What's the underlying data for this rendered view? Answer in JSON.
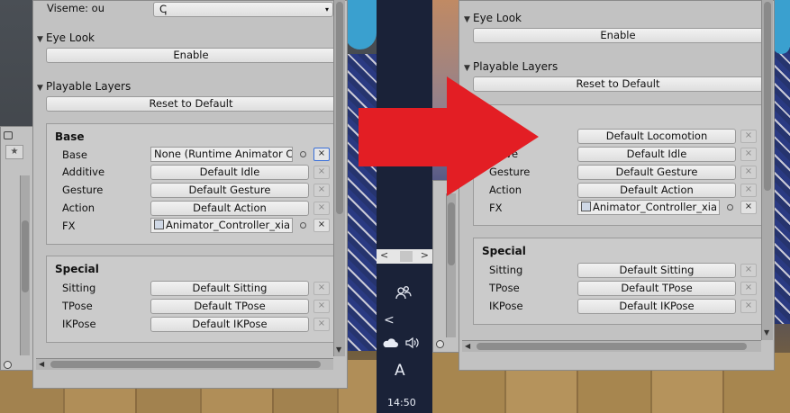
{
  "left_inspector": {
    "viseme_label": "Viseme: ou",
    "viseme_dropdown_value": "ↅ",
    "eye_look_label": "Eye Look",
    "eye_look_button": "Enable",
    "playable_layers_label": "Playable Layers",
    "reset_button": "Reset to Default",
    "base_header": "Base",
    "rows": [
      {
        "label": "Base",
        "value": "None (Runtime Animator C"
      },
      {
        "label": "Additive",
        "value": "Default Idle"
      },
      {
        "label": "Gesture",
        "value": "Default Gesture"
      },
      {
        "label": "Action",
        "value": "Default Action"
      },
      {
        "label": "FX",
        "value": "Animator_Controller_xia"
      }
    ],
    "special_header": "Special",
    "special_rows": [
      {
        "label": "Sitting",
        "value": "Default Sitting"
      },
      {
        "label": "TPose",
        "value": "Default TPose"
      },
      {
        "label": "IKPose",
        "value": "Default IKPose"
      }
    ],
    "x_glyph": "×",
    "star_glyph": "★"
  },
  "right_inspector": {
    "eye_look_label": "Eye Look",
    "eye_look_button": "Enable",
    "playable_layers_label": "Playable Layers",
    "reset_button": "Reset to Default",
    "rows": [
      {
        "label": "",
        "value": "Default Locomotion"
      },
      {
        "label": "ditive",
        "value": "Default Idle"
      },
      {
        "label": "Gesture",
        "value": "Default Gesture"
      },
      {
        "label": "Action",
        "value": "Default Action"
      },
      {
        "label": "FX",
        "value": "Animator_Controller_xia"
      }
    ],
    "special_header": "Special",
    "special_rows": [
      {
        "label": "Sitting",
        "value": "Default Sitting"
      },
      {
        "label": "TPose",
        "value": "Default TPose"
      },
      {
        "label": "IKPose",
        "value": "Default IKPose"
      }
    ],
    "x_glyph": "×"
  },
  "taskbar": {
    "time": "14:50",
    "ime_letter": "A",
    "chevron_left": "<",
    "chevron_right": ">",
    "back_arrow": "<"
  },
  "colors": {
    "arrow": "#e31e24",
    "panel": "#c2c2c2",
    "taskbar": "#1a2238",
    "active_outline": "#3a6fd8"
  }
}
